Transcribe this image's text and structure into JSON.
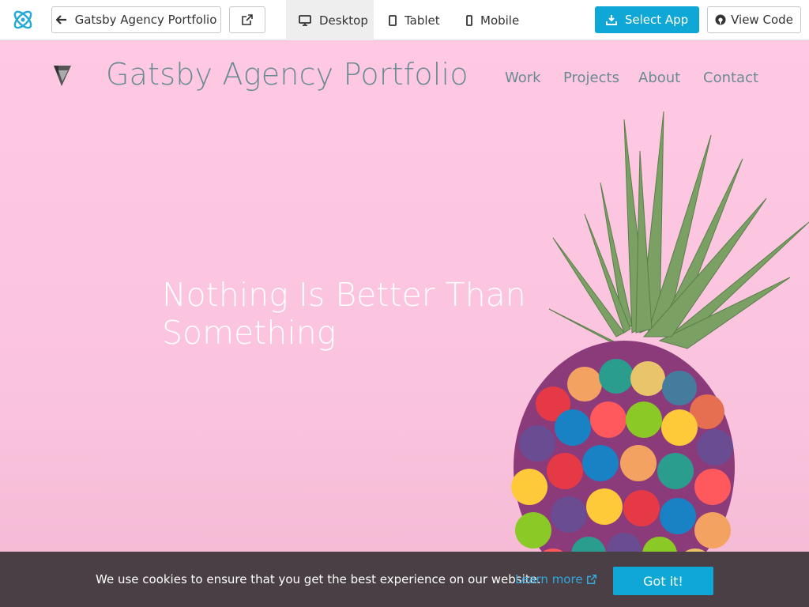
{
  "toolbar": {
    "back_label": "Gatsby Agency Portfolio",
    "devices": {
      "desktop": "Desktop",
      "tablet": "Tablet",
      "mobile": "Mobile"
    },
    "select_app_label": "Select App",
    "view_code_label": "View Code",
    "accent_color": "#0fa8d6"
  },
  "site": {
    "title": "Gatsby Agency Portfolio",
    "nav": [
      "Work",
      "Projects",
      "About",
      "Contact"
    ],
    "headline": "Nothing Is Better Than Something",
    "background_color": "#ffc9e3"
  },
  "cookie": {
    "message": "We use cookies to ensure that you get the best experience on our website.",
    "learn_more": "Learn more",
    "accept_label": "Got it!"
  },
  "icons": [
    "app-logo-icon",
    "arrow-left-icon",
    "external-link-icon",
    "desktop-icon",
    "tablet-icon",
    "mobile-icon",
    "download-icon",
    "github-icon",
    "site-logo-icon"
  ]
}
